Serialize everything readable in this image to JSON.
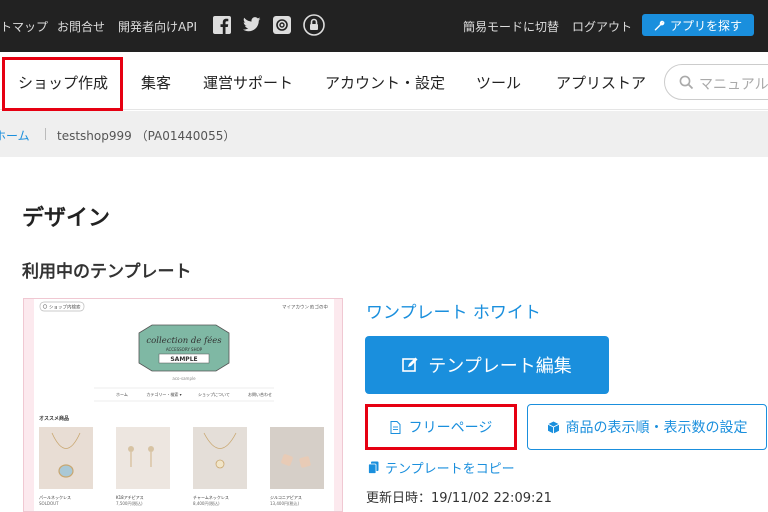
{
  "topbar": {
    "links": [
      "トマップ",
      "お問合せ",
      "開発者向けAPI"
    ],
    "social_icons": [
      "facebook-icon",
      "twitter-icon",
      "at-sign-icon",
      "lock-icon"
    ],
    "simple_mode": "簡易モードに切替",
    "logout": "ログアウト",
    "app_button": "アプリを探す"
  },
  "nav": {
    "items": [
      "ショップ作成",
      "集客",
      "運営サポート",
      "アカウント・設定",
      "ツール",
      "アプリストア"
    ],
    "search_placeholder": "マニュアル"
  },
  "breadcrumb": {
    "home": "ホーム",
    "shop": "testshop999 （PA01440055）"
  },
  "page": {
    "title": "デザイン",
    "section": "利用中のテンプレート"
  },
  "template": {
    "name": "ワンプレート ホワイト",
    "edit_button": "テンプレート編集",
    "free_page_button": "フリーページ",
    "sort_button": "商品の表示順・表示数の設定",
    "copy_link": "テンプレートをコピー",
    "updated": "更新日時：19/11/02 22:09:21"
  },
  "preview": {
    "search": "ショップ内検索",
    "account": "マイアカウント",
    "cart": "カゴの中",
    "logo_line1": "collection de fées",
    "logo_line2": "ACCESSORY SHOP",
    "logo_line3": "SAMPLE",
    "tagline": "aco-sample",
    "menu": [
      "ホーム",
      "カテゴリー・検索 ▾",
      "ショップについて",
      "お問い合わせ"
    ],
    "section": "オススメ商品",
    "products": [
      {
        "name": "パールネックレス",
        "price": "SOLDOUT"
      },
      {
        "name": "K18アチピアス",
        "price": "7,500円(税込)"
      },
      {
        "name": "チャームネックレス",
        "price": "8,400円(税込)"
      },
      {
        "name": "ジルコニアピアス",
        "price": "13,400円(税込)"
      }
    ]
  },
  "colors": {
    "accent": "#1a8fdd",
    "highlight": "#e60012",
    "topbar": "#222222"
  }
}
